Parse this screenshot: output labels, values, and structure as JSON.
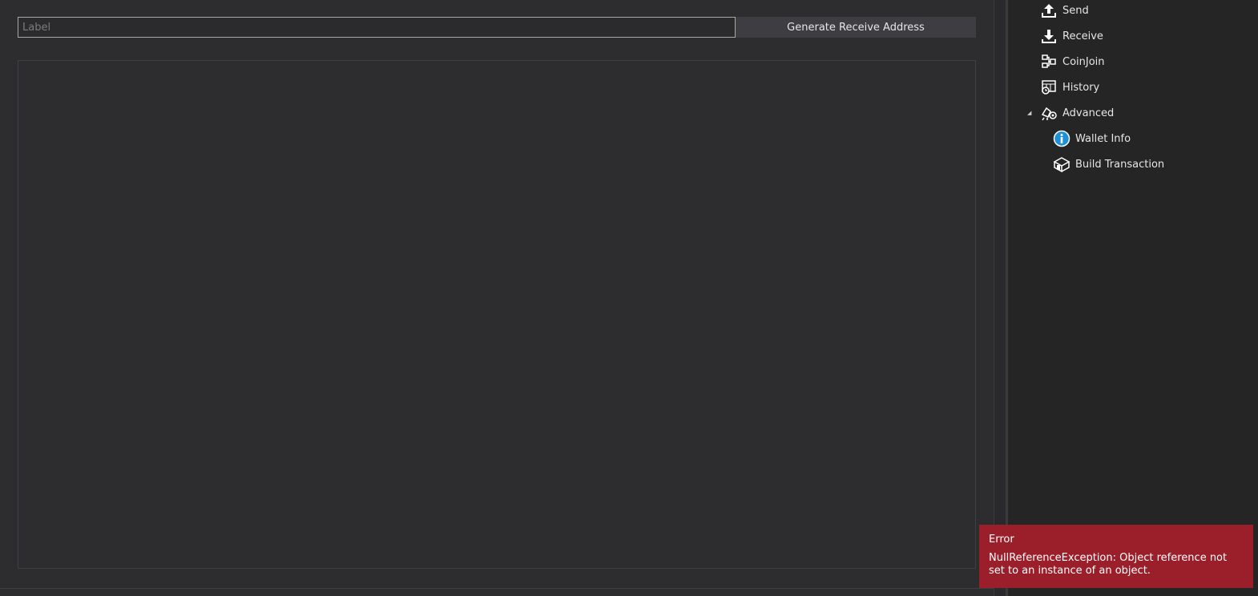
{
  "receive": {
    "label_placeholder": "Label",
    "label_value": "",
    "generate_button": "Generate Receive Address"
  },
  "nav": {
    "send": "Send",
    "receive": "Receive",
    "coinjoin": "CoinJoin",
    "history": "History",
    "advanced": "Advanced",
    "wallet_info": "Wallet Info",
    "build_transaction": "Build Transaction"
  },
  "icons": {
    "send": "upload-arrow-icon",
    "receive": "download-arrow-icon",
    "coinjoin": "coinjoin-icon",
    "history": "history-icon",
    "advanced": "advanced-icon",
    "wallet_info": "info-icon",
    "build_transaction": "build-transaction-icon",
    "expander": "expander-triangle-icon"
  },
  "toast": {
    "title": "Error",
    "message": "NullReferenceException: Object reference not set to an instance of an object.",
    "color": "#9b1f2a"
  },
  "colors": {
    "background": "#2d2d30",
    "panel": "#252526",
    "accent_info": "#1e90d6"
  }
}
